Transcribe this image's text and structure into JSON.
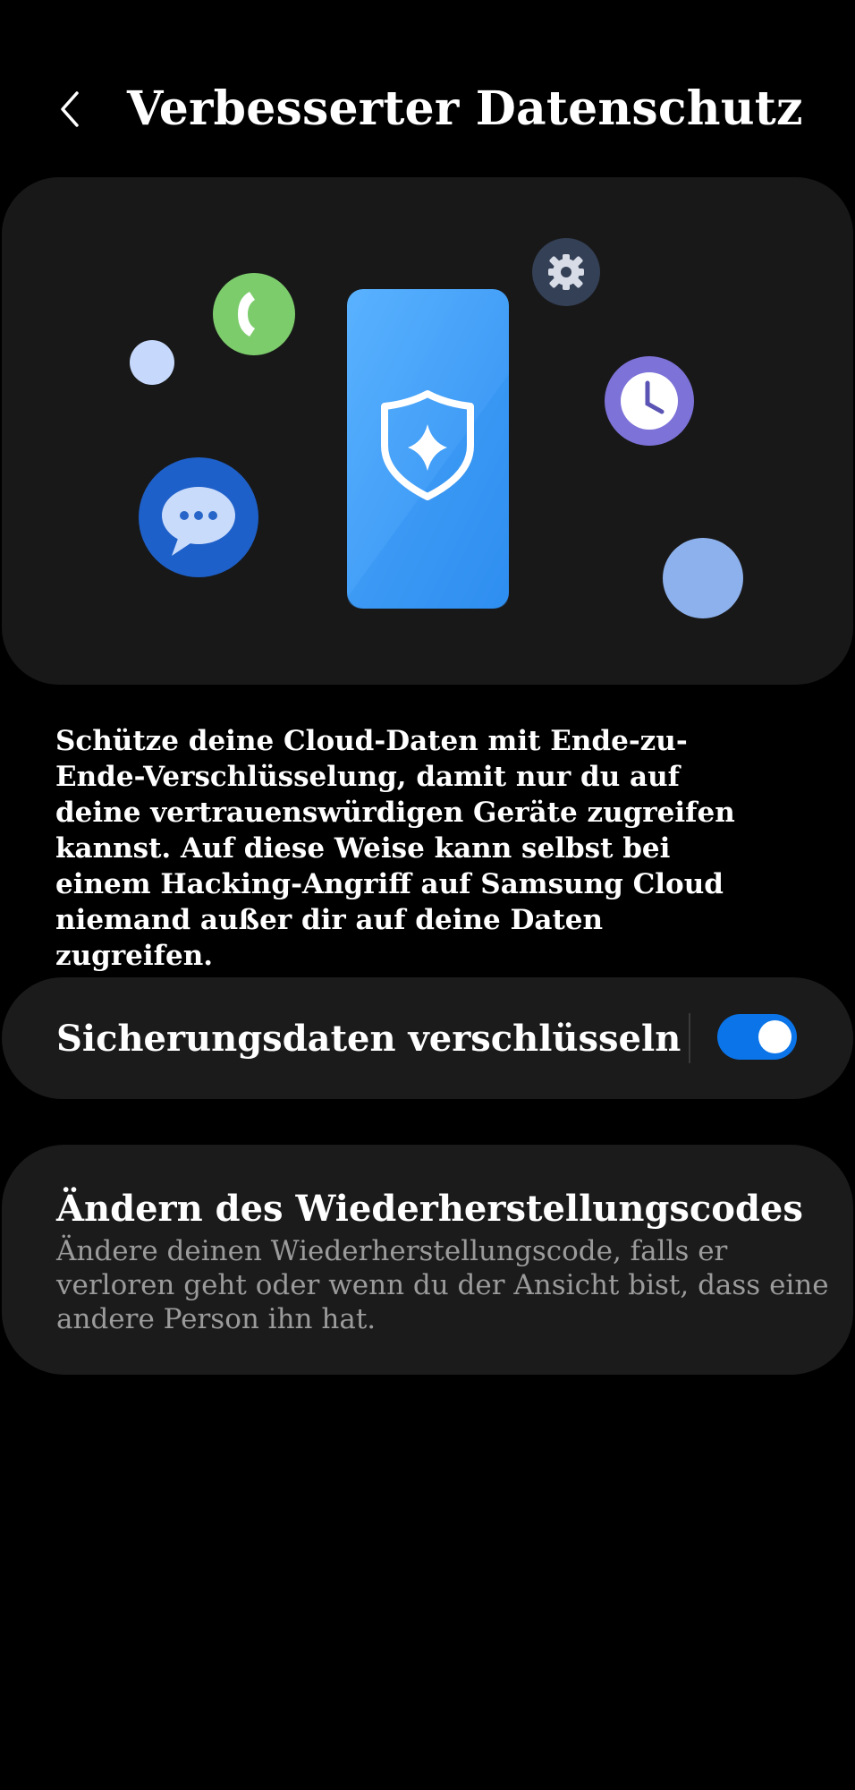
{
  "header": {
    "title": "Verbesserter Datenschutz",
    "back_icon": "chevron-left-icon"
  },
  "hero": {
    "icons": [
      "phone-call-icon",
      "settings-gear-icon",
      "clock-icon",
      "chat-bubble-icon",
      "shield-star-icon"
    ],
    "colors": {
      "card": "#181818",
      "phone_call": "#7ccc6c",
      "gear": "#344056",
      "clock": "#7d72d8",
      "chat": "#1e60c9",
      "bubble_light": "#c6d8fb",
      "bubble_blue": "#8db1ed",
      "device": "#3f9ef3"
    }
  },
  "description": "Schütze deine Cloud-Daten mit Ende-zu-Ende-Verschlüsselung, damit nur du auf deine vertrauenswürdigen Geräte zugreifen kannst. Auf diese Weise kann selbst bei einem Hacking-Angriff auf Samsung Cloud niemand außer dir auf deine Daten zugreifen.",
  "settings": {
    "encrypt": {
      "label": "Sicherungsdaten verschlüsseln",
      "enabled": true
    },
    "recovery": {
      "title": "Ändern des Wiederherstellungscodes",
      "description": "Ändere deinen Wiederherstellungscode, falls er verloren geht oder wenn du der Ansicht bist, dass eine andere Person ihn hat."
    }
  },
  "theme": {
    "background": "#000000",
    "card": "#1b1b1b",
    "text_primary": "#ffffff",
    "text_secondary": "#9b9b9b",
    "accent": "#0a74e8"
  }
}
